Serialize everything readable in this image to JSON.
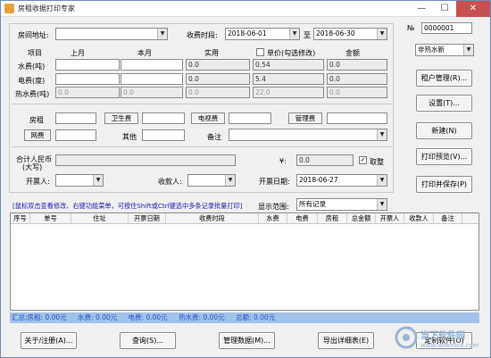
{
  "window": {
    "title": "房租收据打印专家"
  },
  "form": {
    "address_label": "房间地址:",
    "address_value": "",
    "period_label": "收费时段:",
    "period_start": "2018-06-01",
    "period_to": "至",
    "period_end": "2018-06-30",
    "receipt_no_label": "№",
    "receipt_no_value": "0000001",
    "water_type": "非热水新",
    "columns": {
      "item": "项目",
      "last": "上月",
      "this": "本月",
      "used": "实用",
      "price_check": "单价(勾选修改)",
      "amount": "金额"
    },
    "meters": [
      {
        "label": "水费(吨)",
        "last": "",
        "this": "",
        "used": "0.0",
        "price": "0.54",
        "amount": "0.0",
        "disabled": false
      },
      {
        "label": "电费(度)",
        "last": "",
        "this": "",
        "used": "0.0",
        "price": "5.4",
        "amount": "0.0",
        "disabled": false
      },
      {
        "label": "热水费(吨)",
        "last": "0.0",
        "this": "0.0",
        "used": "0.0",
        "price": "22.0",
        "amount": "0.0",
        "disabled": true
      }
    ],
    "fees": {
      "rent_label": "房租",
      "rent_value": "",
      "sanitation_btn": "卫生费",
      "sanitation_value": "",
      "tv_btn": "电视费",
      "tv_value": "",
      "mgmt_btn": "管理费",
      "mgmt_value": "",
      "net_btn": "网费",
      "net_value": "",
      "other_label": "其他",
      "other_value": "",
      "remark_label": "备注",
      "remark_value": ""
    },
    "total_label_1": "合计人民币",
    "total_label_2": "(大写)",
    "total_upper": "",
    "currency_symbol": "¥:",
    "total_value": "0.0",
    "round_label": "取整",
    "round_checked": true,
    "drawer_label": "开票人:",
    "drawer_value": "",
    "payee_label": "收款人:",
    "payee_value": "",
    "date_label": "开票日期:",
    "date_value": "2018-06-27"
  },
  "side_buttons": {
    "tenant": "租户管理(R)...",
    "settings": "设置(T)...",
    "new": "新建(N)",
    "preview": "打印预览(V)...",
    "print_save": "打印并保存(P)"
  },
  "hint": "[鼠标双击查看修改、右键功能菜单，可按住Shift或Ctrl键选中多条记录批量打印]",
  "display_range_label": "显示范围:",
  "display_range_value": "所有记录",
  "table": {
    "headers": [
      "序号",
      "单号",
      "住址",
      "开票日期",
      "收费时段",
      "水费",
      "电费",
      "房租",
      "总金额",
      "开票人",
      "收款人",
      "备注"
    ]
  },
  "summary": {
    "total_label": "汇总:房租: 0.00元",
    "water": "水费: 0.00元",
    "electric": "电费: 0.00元",
    "hot_water": "热水费: 0.00元",
    "grand": "总额: 0.00元"
  },
  "bottom_buttons": {
    "about": "关于/注册(A)...",
    "query": "查询(S)...",
    "manage": "管理数据(M)...",
    "export": "导出详细表(E)",
    "custom": "定制软件(O)"
  },
  "watermark": {
    "text1": "当下软件园",
    "text2": "www.downxia.com"
  }
}
